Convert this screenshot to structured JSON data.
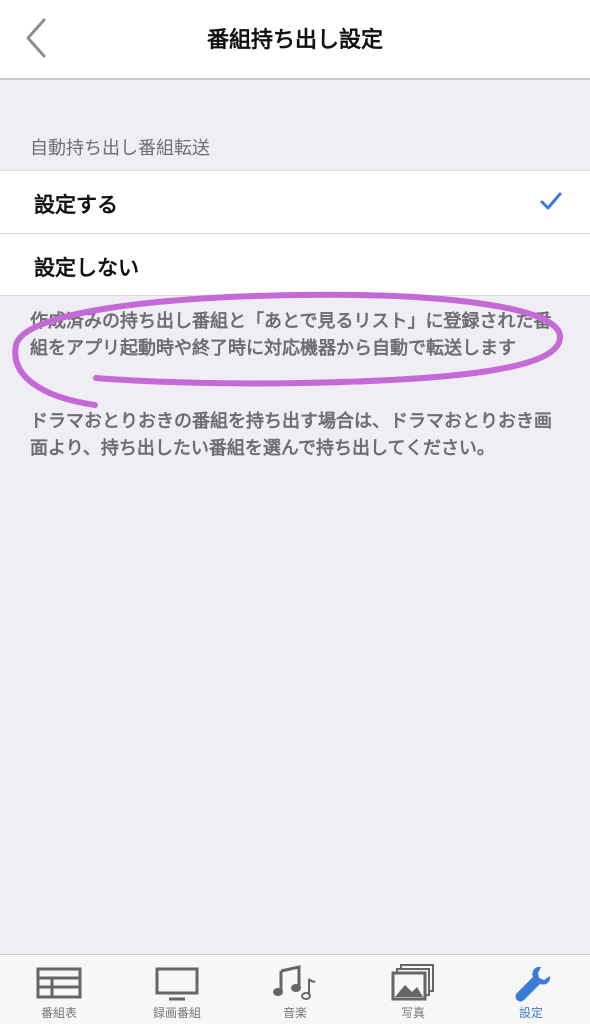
{
  "nav": {
    "title": "番組持ち出し設定",
    "back_icon": "chevron-left-icon"
  },
  "section": {
    "header": "自動持ち出し番組転送",
    "options": [
      {
        "label": "設定する",
        "selected": true
      },
      {
        "label": "設定しない",
        "selected": false
      }
    ]
  },
  "notes": {
    "note1": "作成済みの持ち出し番組と「あとで見るリスト」に登録された番組をアプリ起動時や終了時に対応機器から自動で転送します",
    "note2": "ドラマおとりおきの番組を持ち出す場合は、ドラマおとりおき画面より、持ち出したい番組を選んで持ち出してください。"
  },
  "tabs": [
    {
      "label": "番組表",
      "icon": "grid-table-icon"
    },
    {
      "label": "録画番組",
      "icon": "tv-icon"
    },
    {
      "label": "音楽",
      "icon": "music-note-icon"
    },
    {
      "label": "写真",
      "icon": "photos-icon"
    },
    {
      "label": "設定",
      "icon": "wrench-icon",
      "active": true
    }
  ],
  "colors": {
    "accent": "#3a7bd5",
    "annotation": "#c46ad6",
    "background": "#efeef4"
  }
}
